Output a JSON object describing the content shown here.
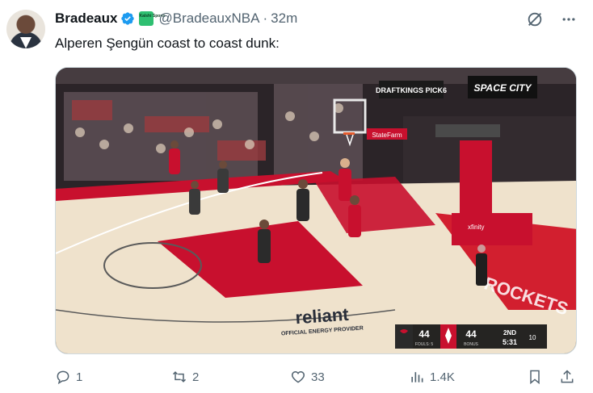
{
  "author": {
    "display_name": "Bradeaux",
    "handle": "@BradeauxNBA",
    "separator": "·",
    "time": "32m",
    "badge_text": "Kalshi Sports"
  },
  "tweet": {
    "text": "Alperen Şengün coast to coast dunk:"
  },
  "media": {
    "overlay_texts": {
      "sponsor_top": "DRAFTKINGS PICK6",
      "space_city": "SPACE CITY",
      "statefarm": "StateFarm",
      "xfinity": "xfinity",
      "reliant": "reliant",
      "reliant_sub": "OFFICIAL ENERGY PROVIDER",
      "floor_brand": "ROCKETS"
    },
    "scoreboard": {
      "away_score": "44",
      "home_score": "44",
      "away_fouls": "FOULS: 5",
      "home_status": "BONUS",
      "period": "2ND",
      "clock": "5:31",
      "shot_clock": "10"
    }
  },
  "actions": {
    "reply_count": "1",
    "retweet_count": "2",
    "like_count": "33",
    "view_count": "1.4K"
  },
  "colors": {
    "verified": "#1d9bf0",
    "court_red": "#c8102e",
    "court_wood": "#efe2cc",
    "muted": "#536471"
  }
}
